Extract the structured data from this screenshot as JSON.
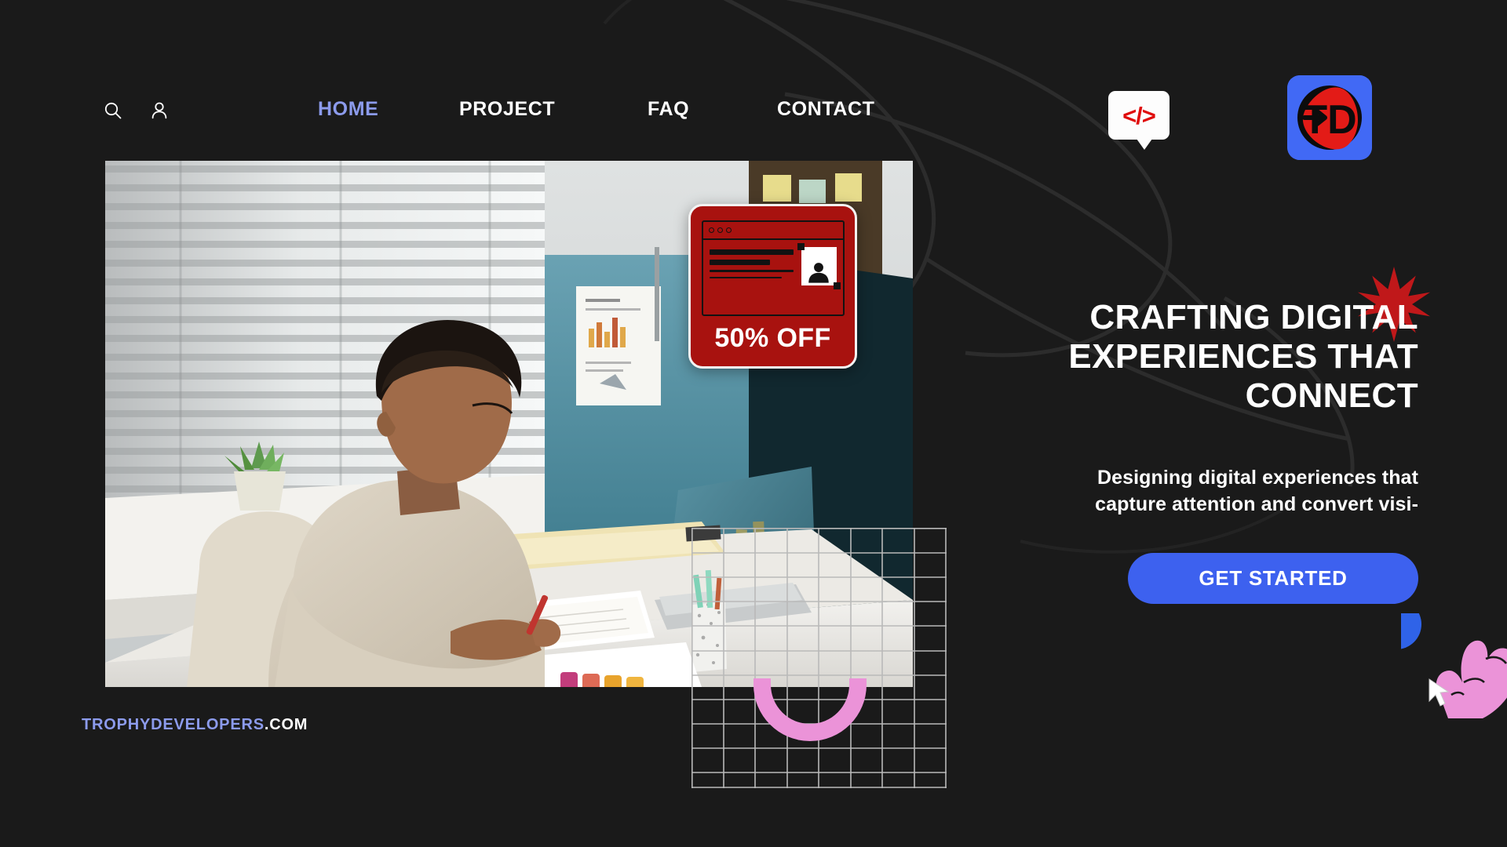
{
  "page": {
    "background_color": "#1a1a1a",
    "accent_blue": "#3d61ef",
    "accent_periwinkle": "#8c9bec",
    "accent_red": "#c0181a",
    "accent_pink": "#eb93d8"
  },
  "nav": {
    "icons": [
      {
        "name": "search-icon",
        "label": "Search"
      },
      {
        "name": "user-icon",
        "label": "Account"
      }
    ],
    "links": [
      {
        "label": "HOME",
        "active": true
      },
      {
        "label": "PROJECT",
        "active": false
      },
      {
        "label": "FAQ",
        "active": false
      },
      {
        "label": "CONTACT",
        "active": false
      }
    ],
    "code_bubble": {
      "glyph": "</>",
      "name": "code-bubble-icon"
    },
    "logo": {
      "letters": "TD",
      "name": "trophy-developers-logo"
    }
  },
  "hero": {
    "photo_alt": "Man working at a desk writing in a notebook beside a window with blinds",
    "badge": {
      "discount_text": "50% OFF",
      "window_dots": 3
    },
    "star_name": "red-starburst-decoration",
    "title": "CRAFTING DIGITAL EXPERIENCES THAT CONNECT",
    "title_lines": [
      "CRAFTING DIGITAL",
      "EXPERIENCES THAT",
      "CONNECT"
    ],
    "subtitle": "Designing digital experiences that capture attention and convert visi-",
    "subtitle_lines": [
      "Designing digital experiences that",
      "capture attention and convert visi-"
    ],
    "cta_label": "GET STARTED",
    "hand_name": "pink-hand-cursor-illustration",
    "grid_name": "grid-decoration",
    "arc_name": "pink-arc-decoration"
  },
  "footer": {
    "brand_primary": "TROPHYDEVELOPERS",
    "brand_suffix": ".COM"
  }
}
